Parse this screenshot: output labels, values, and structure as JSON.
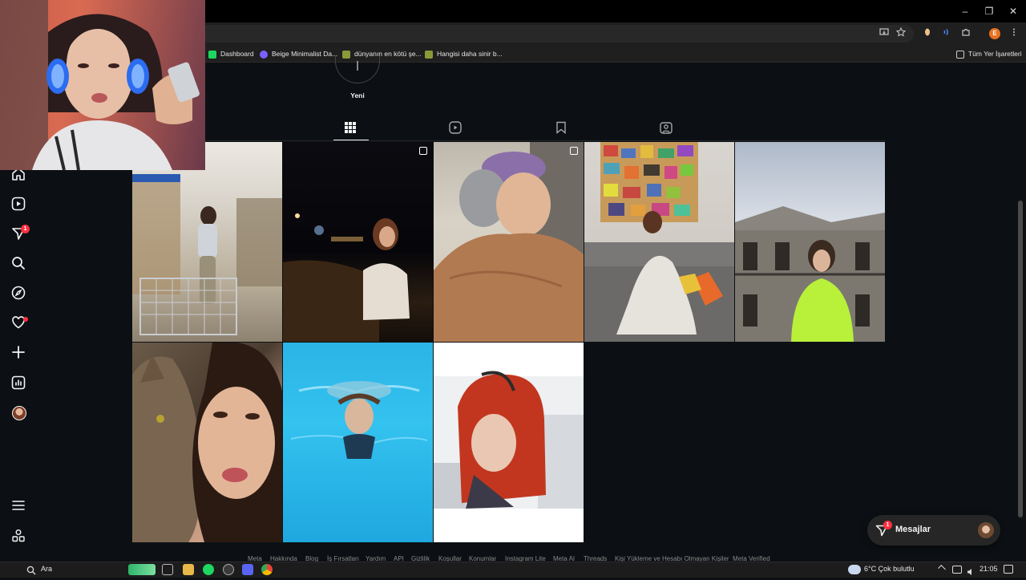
{
  "browser": {
    "window_controls": {
      "minimize": "–",
      "restore": "❐",
      "close": "✕"
    },
    "toolbar_icons": [
      "install-icon",
      "star-icon",
      "extension-icon",
      "extensions-puzzle-icon",
      "menu-icon"
    ],
    "profile_initial": "E",
    "bookmarks": [
      {
        "label": "Dashboard",
        "color": "#1ed760"
      },
      {
        "label": "Beige Minimalist Da...",
        "color": "#7b61ff"
      },
      {
        "label": "dünyanın en kötü şe...",
        "color": "#8a9a3a"
      },
      {
        "label": "Hangisi daha sinir b...",
        "color": "#8a9a3a"
      }
    ],
    "all_bookmarks": "Tüm Yer İşaretleri"
  },
  "profile": {
    "new_highlight_label": "Yeni",
    "tabs": [
      "posts-tab",
      "reels-tab",
      "saved-tab",
      "tagged-tab"
    ],
    "active_tab": "posts-tab"
  },
  "sidebar": {
    "items": [
      "home",
      "reels",
      "messenger",
      "search",
      "explore",
      "notifications",
      "create",
      "insights",
      "profile"
    ],
    "messenger_badge": "1",
    "bottom_items": [
      "more",
      "also-from-meta"
    ]
  },
  "posts": [
    {
      "name": "post-supermarket",
      "multi": false
    },
    {
      "name": "post-night-sea",
      "multi": true
    },
    {
      "name": "post-winter-blanket",
      "multi": true
    },
    {
      "name": "post-collage-sofa",
      "multi": false
    },
    {
      "name": "post-old-house",
      "multi": false
    },
    {
      "name": "post-cat-selfie",
      "multi": false
    },
    {
      "name": "post-underwater",
      "multi": false
    },
    {
      "name": "post-red-hair",
      "multi": false
    }
  ],
  "messages": {
    "label": "Mesajlar",
    "badge": "1"
  },
  "footer": {
    "links": [
      "Meta",
      "Hakkında",
      "Blog",
      "İş Fırsatları",
      "Yardım",
      "API",
      "Gizlilik",
      "Koşullar",
      "Konumlar",
      "Instagram Lite",
      "Meta AI",
      "Threads",
      "Kişi Yükleme ve Hesabı Olmayan Kişiler",
      "Meta Verified"
    ]
  },
  "taskbar": {
    "search_placeholder": "Ara",
    "weather": "6°C  Çok bulutlu",
    "time": "21:05"
  }
}
